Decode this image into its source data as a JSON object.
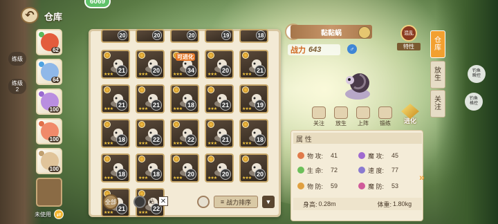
{
  "header": {
    "title": "仓库",
    "coin_value": "6069"
  },
  "side_tags": [
    "练级",
    "练级\n2"
  ],
  "team": [
    {
      "level": "62",
      "color": "#e35c3c"
    },
    {
      "level": "64",
      "color": "#8fb8e8"
    },
    {
      "level": "100",
      "color": "#b98ee0"
    },
    {
      "level": "100",
      "color": "#f08a6a"
    },
    {
      "level": "100",
      "color": "#e0c49a"
    }
  ],
  "team_footer": {
    "unused_label": "未使用"
  },
  "grid": {
    "levels": [
      [
        "20",
        "20",
        "20",
        "19",
        "18"
      ],
      [
        "21",
        "20",
        "34",
        "20",
        "21"
      ],
      [
        "21",
        "21",
        "18",
        "21",
        "19"
      ],
      [
        "18",
        "22",
        "22",
        "21",
        "18"
      ],
      [
        "18",
        "18",
        "20",
        "20",
        "20"
      ],
      [
        "21",
        "22"
      ]
    ],
    "evolvable_label": "可进化"
  },
  "toolbar": {
    "all_label": "全部",
    "mark_label": "贴",
    "sort_label": "战力排序"
  },
  "detail": {
    "name": "黏黏蜗",
    "combat_label": "战力",
    "combat_value": "643",
    "gender": "♂",
    "trait_label": "特性",
    "trait_icon_label": "混乱",
    "actions": [
      "关注",
      "放生",
      "上阵",
      "锻练"
    ],
    "evolve_label": "进化",
    "attr_title": "属 性",
    "stats": [
      {
        "label": "物 攻:",
        "value": "41",
        "color": "#e07a4a"
      },
      {
        "label": "魔 攻:",
        "value": "45",
        "color": "#a06ad0"
      },
      {
        "label": "生 命:",
        "value": "72",
        "color": "#6cbf5a"
      },
      {
        "label": "速 度:",
        "value": "77",
        "color": "#8a7ad0"
      },
      {
        "label": "物 防:",
        "value": "59",
        "color": "#e0a040"
      },
      {
        "label": "魔 防:",
        "value": "53",
        "color": "#d05a9a"
      }
    ],
    "height_label": "身高:",
    "height_value": "0.28m",
    "weight_label": "体重:",
    "weight_value": "1.80kg"
  },
  "tabs": [
    "仓\n库",
    "放\n生",
    "关\n注"
  ],
  "fishing": [
    "钓鱼\n瞬控",
    "钓鱼\n格控"
  ]
}
